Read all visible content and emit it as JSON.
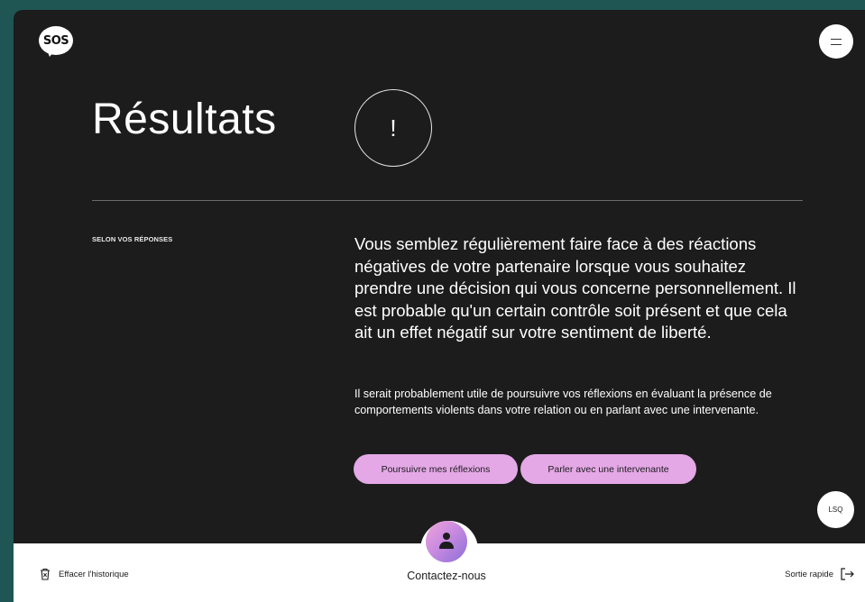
{
  "header": {
    "logo_text": "SOS",
    "menu_icon": "menu-icon"
  },
  "main": {
    "title": "Résultats",
    "alert_symbol": "!",
    "section_label": "SELON VOS RÉPONSES",
    "result_text": "Vous semblez régulièrement faire face à des réactions négatives de votre partenaire lorsque vous souhaitez prendre une décision qui vous concerne personnellement. Il est probable qu'un certain contrôle soit présent et que cela ait un effet négatif sur votre sentiment de liberté.",
    "sub_text": "Il serait probablement utile de poursuivre vos réflexions en évaluant la présence de comportements violents dans votre relation ou en parlant avec une intervenante.",
    "buttons": {
      "continue": "Poursuivre mes réflexions",
      "talk": "Parler avec une intervenante"
    }
  },
  "lsq_button": "LSQ",
  "footer": {
    "clear_history": "Effacer l'historique",
    "contact": "Contactez-nous",
    "quick_exit": "Sortie rapide"
  },
  "colors": {
    "background_panel": "#1c1c1d",
    "outer": "#1f5553",
    "button_accent": "#e4a8e6"
  }
}
